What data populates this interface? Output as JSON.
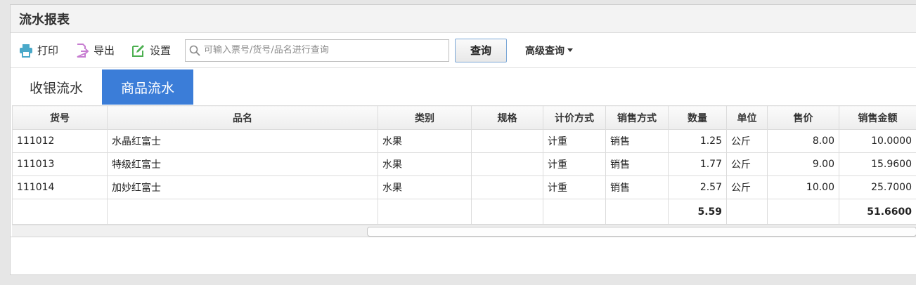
{
  "header": {
    "title": "流水报表"
  },
  "toolbar": {
    "print_label": "打印",
    "export_label": "导出",
    "settings_label": "设置",
    "search_placeholder": "可输入票号/货号/品名进行查询",
    "search_value": "",
    "query_label": "查询",
    "advanced_label": "高级查询"
  },
  "tabs": [
    {
      "label": "收银流水",
      "active": false
    },
    {
      "label": "商品流水",
      "active": true
    }
  ],
  "table": {
    "columns": [
      "货号",
      "品名",
      "类别",
      "规格",
      "计价方式",
      "销售方式",
      "数量",
      "单位",
      "售价",
      "销售金额"
    ],
    "rows": [
      [
        "111012",
        "水晶红富士",
        "水果",
        "",
        "计重",
        "销售",
        "1.25",
        "公斤",
        "8.00",
        "10.0000"
      ],
      [
        "111013",
        "特级红富士",
        "水果",
        "",
        "计重",
        "销售",
        "1.77",
        "公斤",
        "9.00",
        "15.9600"
      ],
      [
        "111014",
        "加妙红富士",
        "水果",
        "",
        "计重",
        "销售",
        "2.57",
        "公斤",
        "10.00",
        "25.7000"
      ]
    ],
    "total": {
      "qty": "5.59",
      "amount": "51.6600"
    }
  },
  "colors": {
    "accent": "#3b7dd8",
    "print_icon": "#4aa9c9",
    "export_icon": "#c77dd1",
    "settings_icon": "#4caf50"
  },
  "icons": {
    "print": "printer-icon",
    "export": "export-icon",
    "settings": "edit-icon",
    "search": "search-icon"
  }
}
